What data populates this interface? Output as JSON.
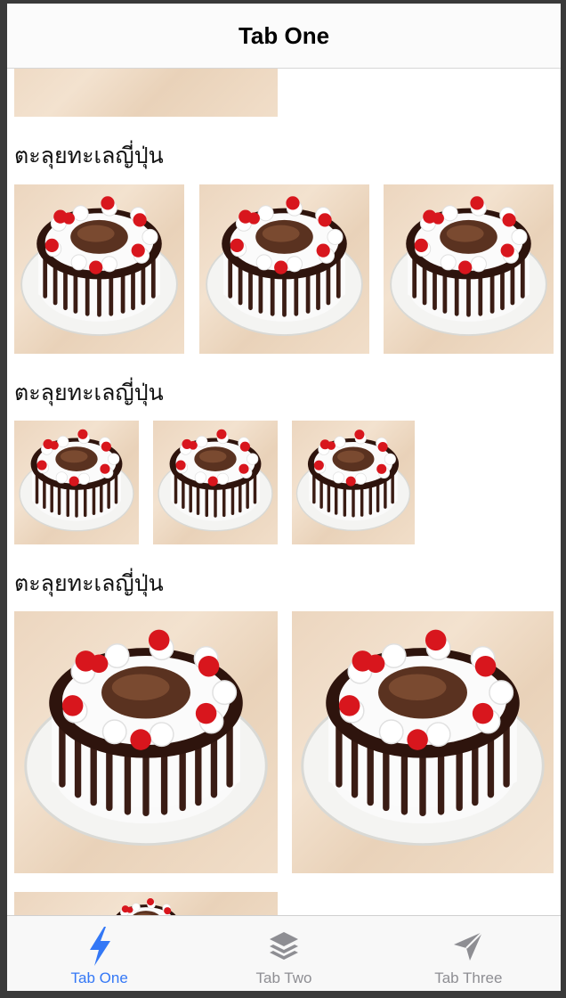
{
  "navbar": {
    "title": "Tab One"
  },
  "sections": [
    {
      "title": "ตะลุยทะเลญี่ปุ่น"
    },
    {
      "title": "ตะลุยทะเลญี่ปุ่น"
    },
    {
      "title": "ตะลุยทะเลญี่ปุ่น"
    }
  ],
  "tabbar": {
    "tabs": [
      {
        "label": "Tab One",
        "icon": "lightning-icon",
        "active": true
      },
      {
        "label": "Tab Two",
        "icon": "layers-icon",
        "active": false
      },
      {
        "label": "Tab Three",
        "icon": "navigation-arrow-icon",
        "active": false
      }
    ]
  },
  "colors": {
    "accent": "#3478f6",
    "inactive": "#8e8e93"
  }
}
